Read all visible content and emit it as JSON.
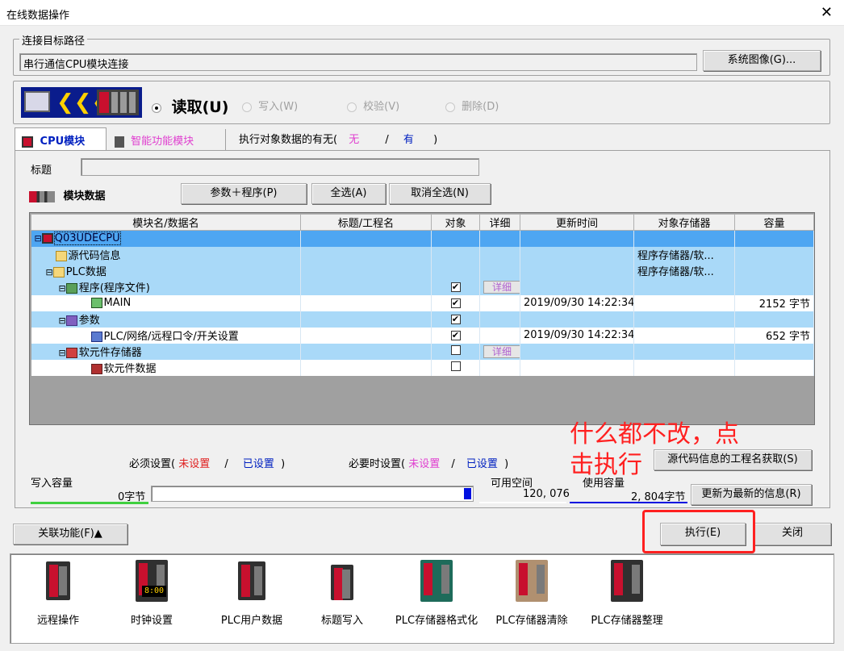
{
  "window": {
    "title": "在线数据操作",
    "close_glyph": "✕"
  },
  "connection": {
    "legend": "连接目标路径",
    "path_value": "串行通信CPU模块连接",
    "system_image_button": "系统图像(G)..."
  },
  "mode": {
    "read_label": "读取(U)",
    "write_label": "写入(W)",
    "verify_label": "校验(V)",
    "delete_label": "删除(D)",
    "selected": "read"
  },
  "tabs": {
    "cpu_tab": "CPU模块",
    "smart_tab": "智能功能模块",
    "target_data_label": "执行对象数据的有无(",
    "none_label": "无",
    "slash": "/",
    "has_label": "有",
    "close_paren": ")"
  },
  "form": {
    "title_label": "标题",
    "title_value": "",
    "module_data_label": "模块数据",
    "param_program_button": "参数＋程序(P)",
    "select_all_button": "全选(A)",
    "deselect_all_button": "取消全选(N)"
  },
  "table": {
    "headers": [
      "模块名/数据名",
      "标题/工程名",
      "对象",
      "详细",
      "更新时间",
      "对象存储器",
      "容量"
    ],
    "rows": [
      {
        "name": "Q03UDECPU",
        "title": "",
        "target": "",
        "detail": "",
        "time": "",
        "memory": "",
        "size": "",
        "style": "sel"
      },
      {
        "name": "源代码信息",
        "title": "",
        "target": "",
        "detail": "",
        "time": "",
        "memory": "程序存储器/软...",
        "size": "",
        "style": "lb"
      },
      {
        "name": "PLC数据",
        "title": "",
        "target": "",
        "detail": "",
        "time": "",
        "memory": "程序存储器/软...",
        "size": "",
        "style": "lb"
      },
      {
        "name": "程序(程序文件)",
        "title": "",
        "target": "✔",
        "detail": "详细",
        "time": "",
        "memory": "",
        "size": "",
        "style": "lb"
      },
      {
        "name": "MAIN",
        "title": "",
        "target": "✔",
        "detail": "",
        "time": "2019/09/30 14:22:34",
        "memory": "",
        "size": "2152 字节",
        "style": "wh"
      },
      {
        "name": "参数",
        "title": "",
        "target": "✔",
        "detail": "",
        "time": "",
        "memory": "",
        "size": "",
        "style": "lb"
      },
      {
        "name": "PLC/网络/远程口令/开关设置",
        "title": "",
        "target": "✔",
        "detail": "",
        "time": "2019/09/30 14:22:34",
        "memory": "",
        "size": "652 字节",
        "style": "wh"
      },
      {
        "name": "软元件存储器",
        "title": "",
        "target": "",
        "detail": "详细",
        "time": "",
        "memory": "",
        "size": "",
        "style": "lb"
      },
      {
        "name": "软元件数据",
        "title": "",
        "target": "",
        "detail": "",
        "time": "",
        "memory": "",
        "size": "",
        "style": "wh"
      }
    ]
  },
  "settings": {
    "required_label": "必须设置(",
    "not_set": "未设置",
    "slash": "/",
    "set": "已设置",
    "close_paren": ")",
    "optional_label": "必要时设置(",
    "get_project_name_button": "源代码信息的工程名获取(S)"
  },
  "capacity": {
    "write_capacity_label": "写入容量",
    "write_bytes": "0字节",
    "free_space_label": "可用空间",
    "free_space_value": "120, 076",
    "used_label": "使用容量",
    "used_value": "2, 804字节",
    "refresh_button": "更新为最新的信息(R)"
  },
  "annotation": {
    "text_line1": "什么都不改，点",
    "text_line2": "击执行",
    "color": "#ff2020"
  },
  "footer": {
    "related_button": "关联功能(F)▲",
    "execute_button": "执行(E)",
    "close_button": "关闭"
  },
  "tools": [
    {
      "label": "远程操作",
      "icon": "remote-operation-icon"
    },
    {
      "label": "时钟设置",
      "icon": "clock-setting-icon"
    },
    {
      "label": "PLC用户数据",
      "icon": "plc-user-data-icon"
    },
    {
      "label": "标题写入",
      "icon": "title-write-icon"
    },
    {
      "label": "PLC存储器格式化",
      "icon": "plc-memory-format-icon"
    },
    {
      "label": "PLC存储器清除",
      "icon": "plc-memory-clear-icon"
    },
    {
      "label": "PLC存储器整理",
      "icon": "plc-memory-arrange-icon"
    }
  ],
  "extra_display": {
    "clock_text": "8:00"
  }
}
